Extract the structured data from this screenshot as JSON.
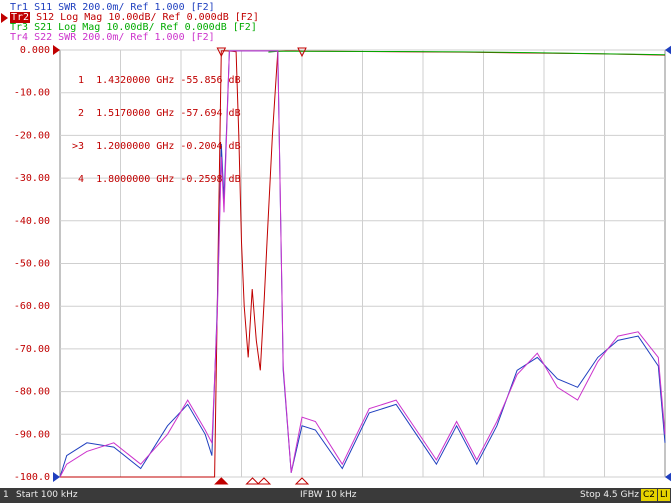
{
  "traces": [
    {
      "label": "Tr1 S11 SWR 200.0m/ Ref 1.000 [F2]",
      "color": "#1f3fbf"
    },
    {
      "badge": "Tr2",
      "label": " S12 Log Mag 10.00dB/ Ref 0.000dB [F2]",
      "color": "#c00000"
    },
    {
      "label": "Tr3 S21 Log Mag 10.00dB/ Ref 0.000dB [F2]",
      "color": "#00aa00"
    },
    {
      "label": "Tr4 S22 SWR 200.0m/ Ref 1.000 [F2]",
      "color": "#cc33cc"
    }
  ],
  "markers": [
    {
      "label": "  1  1.4320000 GHz -55.856 dB"
    },
    {
      "label": "  2  1.5170000 GHz -57.694 dB"
    },
    {
      "label": " >3  1.2000000 GHz -0.2004 dB"
    },
    {
      "label": "  4  1.8000000 GHz -0.2598 dB"
    }
  ],
  "chart_data": {
    "type": "line",
    "ylabels": [
      "0.000",
      "-10.00",
      "-20.00",
      "-30.00",
      "-40.00",
      "-50.00",
      "-60.00",
      "-70.00",
      "-80.00",
      "-90.00",
      "-100.0"
    ],
    "ylim": [
      -100,
      0
    ],
    "xlim": [
      0.0001,
      4.5
    ],
    "grid": true,
    "series": [
      {
        "name": "S12",
        "color": "#c00000",
        "x": [
          0.0001,
          1.05,
          1.15,
          1.2,
          1.24,
          1.28,
          1.31,
          1.33,
          1.35,
          1.37,
          1.4,
          1.43,
          1.46,
          1.49,
          1.52,
          1.54,
          1.58,
          1.62,
          1.68,
          1.75,
          1.8,
          2.0,
          2.5,
          3.0,
          3.5,
          4.0,
          4.5
        ],
        "y": [
          -100,
          -100,
          -100,
          -0.2,
          -0.2,
          -0.3,
          -0.4,
          -20,
          -45,
          -60,
          -72,
          -56,
          -68,
          -75,
          -58,
          -45,
          -20,
          -0.3,
          -0.2,
          -0.2,
          -0.26,
          -0.3,
          -0.4,
          -0.5,
          -0.7,
          -0.9,
          -1.2
        ]
      },
      {
        "name": "S21",
        "color": "#00aa00",
        "x": [
          1.55,
          1.62,
          1.8,
          2.5,
          3.0,
          3.5,
          4.0,
          4.5
        ],
        "y": [
          -0.5,
          -0.3,
          -0.3,
          -0.35,
          -0.45,
          -0.6,
          -0.9,
          -1.1
        ]
      },
      {
        "name": "S11",
        "color": "#1f3fbf",
        "x": [
          0.0001,
          0.05,
          0.2,
          0.4,
          0.6,
          0.8,
          0.95,
          1.08,
          1.13,
          1.17,
          1.2,
          1.22,
          1.26,
          1.32,
          1.38,
          1.45,
          1.52,
          1.58,
          1.62,
          1.66,
          1.72,
          1.8,
          1.9,
          2.1,
          2.3,
          2.5,
          2.65,
          2.8,
          2.95,
          3.1,
          3.25,
          3.4,
          3.55,
          3.7,
          3.85,
          4.0,
          4.15,
          4.3,
          4.45,
          4.5
        ],
        "y": [
          -100,
          -95,
          -92,
          -93,
          -98,
          -88,
          -83,
          -90,
          -95,
          -60,
          -22,
          -35,
          -0.2,
          -0.2,
          -0.2,
          -0.2,
          -0.2,
          -0.2,
          -0.2,
          -75,
          -99,
          -88,
          -89,
          -98,
          -85,
          -83,
          -90,
          -97,
          -88,
          -97,
          -88,
          -75,
          -72,
          -77,
          -79,
          -72,
          -68,
          -67,
          -74,
          -92
        ]
      },
      {
        "name": "S22",
        "color": "#cc33cc",
        "x": [
          0.0001,
          0.05,
          0.2,
          0.4,
          0.6,
          0.8,
          0.95,
          1.08,
          1.13,
          1.17,
          1.2,
          1.22,
          1.26,
          1.32,
          1.38,
          1.45,
          1.52,
          1.58,
          1.62,
          1.66,
          1.72,
          1.8,
          1.9,
          2.1,
          2.3,
          2.5,
          2.65,
          2.8,
          2.95,
          3.1,
          3.25,
          3.4,
          3.55,
          3.7,
          3.85,
          4.0,
          4.15,
          4.3,
          4.45,
          4.5
        ],
        "y": [
          -100,
          -97,
          -94,
          -92,
          -97,
          -90,
          -82,
          -89,
          -92,
          -62,
          -25,
          -38,
          -0.2,
          -0.2,
          -0.2,
          -0.2,
          -0.2,
          -0.2,
          -0.2,
          -74,
          -99,
          -86,
          -87,
          -97,
          -84,
          -82,
          -89,
          -96,
          -87,
          -96,
          -87,
          -76,
          -71,
          -79,
          -82,
          -73,
          -67,
          -66,
          -72,
          -90
        ]
      }
    ]
  },
  "status": {
    "channel": "1",
    "start": "Start 100 kHz",
    "ifbw": "IFBW 10 kHz",
    "stop": "Stop 4.5 GHz",
    "c2": "C2",
    "li": "LI"
  }
}
